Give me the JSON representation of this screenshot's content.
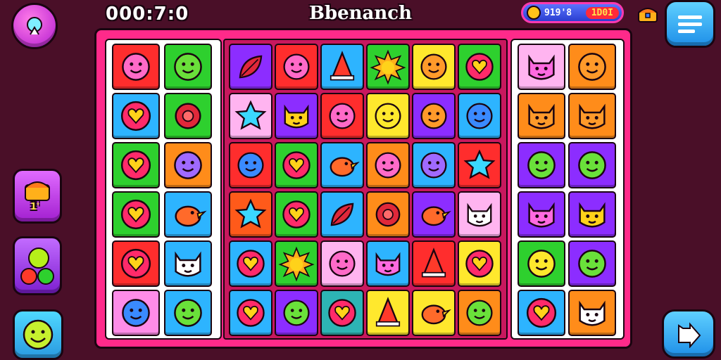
{
  "hud": {
    "timer": "000:7:0",
    "title": "Bbenanch",
    "stat_value": "919'8",
    "stat_badge": "1D0I",
    "side_badge": "1'",
    "buttons": {
      "top_left": "hint-icon",
      "menu": "menu-icon",
      "next": "next-arrow-icon",
      "side_1": "treasure-icon",
      "side_2": "bomb-icon",
      "side_3": "smiley-icon",
      "chest": "chest-icon"
    }
  },
  "board": {
    "left_grid": [
      [
        {
          "bg": "#ff2d2d",
          "icon": "pink-face"
        },
        {
          "bg": "#2ed02e",
          "icon": "green-face"
        }
      ],
      [
        {
          "bg": "#2db4ff",
          "icon": "heart"
        },
        {
          "bg": "#2ed02e",
          "icon": "red-flower"
        }
      ],
      [
        {
          "bg": "#2ed02e",
          "icon": "heart"
        },
        {
          "bg": "#ff8c1a",
          "icon": "purple-face"
        }
      ],
      [
        {
          "bg": "#2ed02e",
          "icon": "heart"
        },
        {
          "bg": "#2db4ff",
          "icon": "bird"
        }
      ],
      [
        {
          "bg": "#ff2d2d",
          "icon": "heart"
        },
        {
          "bg": "#2db4ff",
          "icon": "white-cat"
        }
      ],
      [
        {
          "bg": "#ff8ce8",
          "icon": "blue-face"
        },
        {
          "bg": "#2db4ff",
          "icon": "green-face"
        }
      ]
    ],
    "mid_grid": [
      [
        {
          "bg": "#8c2dff",
          "icon": "red-leaf"
        },
        {
          "bg": "#ff2d2d",
          "icon": "pink-face"
        },
        {
          "bg": "#2db4ff",
          "icon": "cone"
        },
        {
          "bg": "#2ed02e",
          "icon": "sun"
        },
        {
          "bg": "#ffe82d",
          "icon": "orange-face"
        },
        {
          "bg": "#2ed02e",
          "icon": "heart"
        }
      ],
      [
        {
          "bg": "#ffb4f0",
          "icon": "star"
        },
        {
          "bg": "#8c2dff",
          "icon": "yellow-cat"
        },
        {
          "bg": "#ff2d2d",
          "icon": "pink-face"
        },
        {
          "bg": "#ffe82d",
          "icon": "yellow-face"
        },
        {
          "bg": "#8c2dff",
          "icon": "orange-face"
        },
        {
          "bg": "#2db4ff",
          "icon": "blue-face"
        }
      ],
      [
        {
          "bg": "#ff2d2d",
          "icon": "blue-face"
        },
        {
          "bg": "#2ed02e",
          "icon": "heart"
        },
        {
          "bg": "#2db4ff",
          "icon": "bird"
        },
        {
          "bg": "#ff8c1a",
          "icon": "pink-face"
        },
        {
          "bg": "#2db4ff",
          "icon": "purple-face"
        },
        {
          "bg": "#ff2d2d",
          "icon": "star"
        }
      ],
      [
        {
          "bg": "#ff5a1a",
          "icon": "star"
        },
        {
          "bg": "#2ed02e",
          "icon": "heart"
        },
        {
          "bg": "#2db4ff",
          "icon": "red-leaf"
        },
        {
          "bg": "#ff8c1a",
          "icon": "red-flower"
        },
        {
          "bg": "#8c2dff",
          "icon": "bird"
        },
        {
          "bg": "#ffb4f0",
          "icon": "white-cat"
        }
      ],
      [
        {
          "bg": "#2db4ff",
          "icon": "heart"
        },
        {
          "bg": "#2ed02e",
          "icon": "sun"
        },
        {
          "bg": "#ffb4f0",
          "icon": "pink-face"
        },
        {
          "bg": "#2db4ff",
          "icon": "pink-cat"
        },
        {
          "bg": "#ff2d2d",
          "icon": "cone"
        },
        {
          "bg": "#ffe82d",
          "icon": "heart"
        }
      ],
      [
        {
          "bg": "#2db4ff",
          "icon": "heart"
        },
        {
          "bg": "#8c2dff",
          "icon": "green-face"
        },
        {
          "bg": "#2db4b4",
          "icon": "heart"
        },
        {
          "bg": "#ffe82d",
          "icon": "cone"
        },
        {
          "bg": "#ffe82d",
          "icon": "bird"
        },
        {
          "bg": "#ff8c1a",
          "icon": "green-face"
        }
      ]
    ],
    "right_grid": [
      [
        {
          "bg": "#ffb4f0",
          "icon": "pink-cat"
        },
        {
          "bg": "#ff8c1a",
          "icon": "orange-face"
        }
      ],
      [
        {
          "bg": "#ff8c1a",
          "icon": "orange-cat"
        },
        {
          "bg": "#ff8c1a",
          "icon": "orange-cat"
        }
      ],
      [
        {
          "bg": "#8c2dff",
          "icon": "green-face"
        },
        {
          "bg": "#8c2dff",
          "icon": "green-face"
        }
      ],
      [
        {
          "bg": "#8c2dff",
          "icon": "pink-cat"
        },
        {
          "bg": "#8c2dff",
          "icon": "yellow-cat"
        }
      ],
      [
        {
          "bg": "#2ed02e",
          "icon": "yellow-face"
        },
        {
          "bg": "#8c2dff",
          "icon": "green-face"
        }
      ],
      [
        {
          "bg": "#2db4ff",
          "icon": "heart"
        },
        {
          "bg": "#ff8c1a",
          "icon": "white-cat"
        }
      ]
    ]
  }
}
